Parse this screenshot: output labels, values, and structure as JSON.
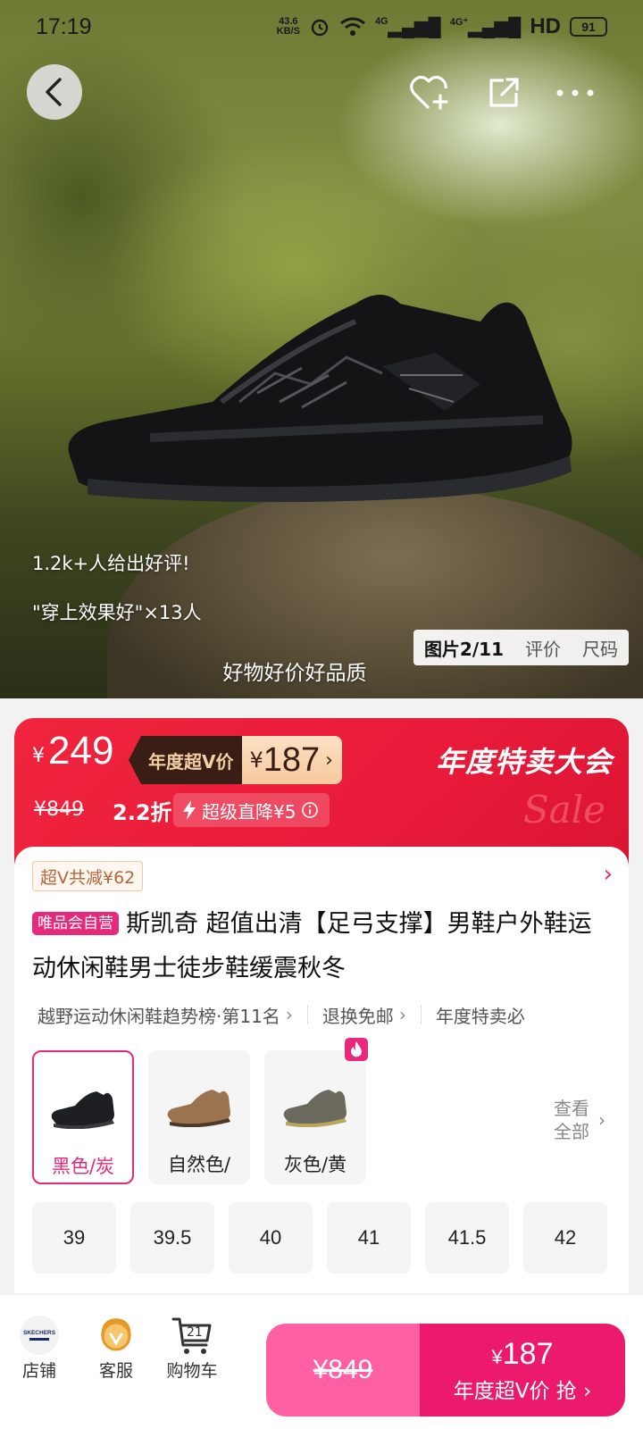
{
  "status_bar": {
    "time": "17:19",
    "net_speed_value": "43.6",
    "net_speed_unit": "KB/S",
    "signal_1": "4G",
    "signal_2": "4G⁺",
    "hd_label": "HD",
    "battery": "91"
  },
  "hero": {
    "review_text": "1.2k+人给出好评!",
    "effect_text": "\"穿上效果好\"×13人",
    "caption": "好物好价好品质",
    "tabs": [
      {
        "label": "图片2/11"
      },
      {
        "label": "评价"
      },
      {
        "label": "尺码"
      }
    ]
  },
  "price_banner": {
    "currency": "¥",
    "price": "249",
    "vip_label": "年度超V价",
    "vip_currency": "¥",
    "vip_price": "187",
    "event_title": "年度特卖大会",
    "sale_script": "Sale",
    "original_price": "¥849",
    "discount": "2.2折",
    "drop_label": "超级直降¥5"
  },
  "product": {
    "coupon": "超V共减¥62",
    "self_operated_tag": "唯品会自营",
    "title": "斯凯奇 超值出清【足弓支撑】男鞋户外鞋运动休闲鞋男士徒步鞋缓震秋冬",
    "rank_items": [
      "越野运动休闲鞋趋势榜·第11名",
      "退换免邮",
      "年度特卖必"
    ],
    "colors": [
      {
        "label": "黑色/炭",
        "selected": true,
        "shoe_color": "#1e1f22"
      },
      {
        "label": "自然色/",
        "selected": false,
        "shoe_color": "#9a7450"
      },
      {
        "label": "灰色/黄",
        "selected": false,
        "shoe_color": "#6c6a5e"
      }
    ],
    "view_all": "查看全部",
    "sizes": [
      "39",
      "39.5",
      "40",
      "41",
      "41.5",
      "42"
    ]
  },
  "bottom_bar": {
    "store_label": "店铺",
    "store_logo_text": "SKECHERS",
    "service_label": "客服",
    "cart_label": "购物车",
    "cart_count": "21",
    "buy_original": "¥849",
    "buy_currency": "¥",
    "buy_price": "187",
    "buy_label": "年度超V价 抢"
  },
  "colors": {
    "accent_pink": "#e8287a",
    "banner_red": "#f0253c",
    "vip_dark": "#3a1d14",
    "buy_pink": "#ec1a6c"
  }
}
